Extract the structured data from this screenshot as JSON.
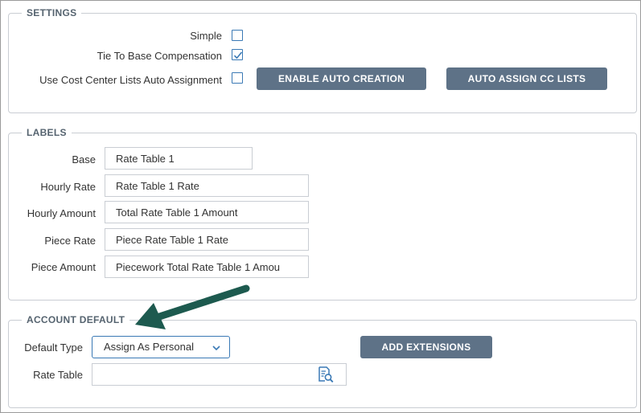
{
  "settings": {
    "legend": "SETTINGS",
    "simple_label": "Simple",
    "simple_checked": false,
    "tie_label": "Tie To Base Compensation",
    "tie_checked": true,
    "cc_label": "Use Cost Center Lists Auto Assignment",
    "cc_checked": false,
    "enable_auto_creation": "ENABLE AUTO CREATION",
    "auto_assign_cc_lists": "AUTO ASSIGN CC LISTS"
  },
  "labels": {
    "legend": "LABELS",
    "base_label": "Base",
    "base_value": "Rate Table 1",
    "hourly_rate_label": "Hourly Rate",
    "hourly_rate_value": "Rate Table 1 Rate",
    "hourly_amount_label": "Hourly Amount",
    "hourly_amount_value": "Total Rate Table 1 Amount",
    "piece_rate_label": "Piece Rate",
    "piece_rate_value": "Piece Rate Table 1 Rate",
    "piece_amount_label": "Piece Amount",
    "piece_amount_value": "Piecework Total Rate Table 1 Amou"
  },
  "account_default": {
    "legend": "ACCOUNT DEFAULT",
    "default_type_label": "Default Type",
    "default_type_value": "Assign As Personal",
    "add_extensions": "ADD EXTENSIONS",
    "rate_table_label": "Rate Table",
    "rate_table_value": ""
  },
  "icons": {
    "dropdown": "chevron-down-icon",
    "lookup": "document-search-icon",
    "checkmark": "check-icon",
    "annotation": "annotation-arrow-icon"
  },
  "colors": {
    "button_bg": "#5e7287",
    "accent_blue": "#3a79b5",
    "legend_text": "#55636f",
    "annotation_arrow": "#1d5a4f"
  }
}
